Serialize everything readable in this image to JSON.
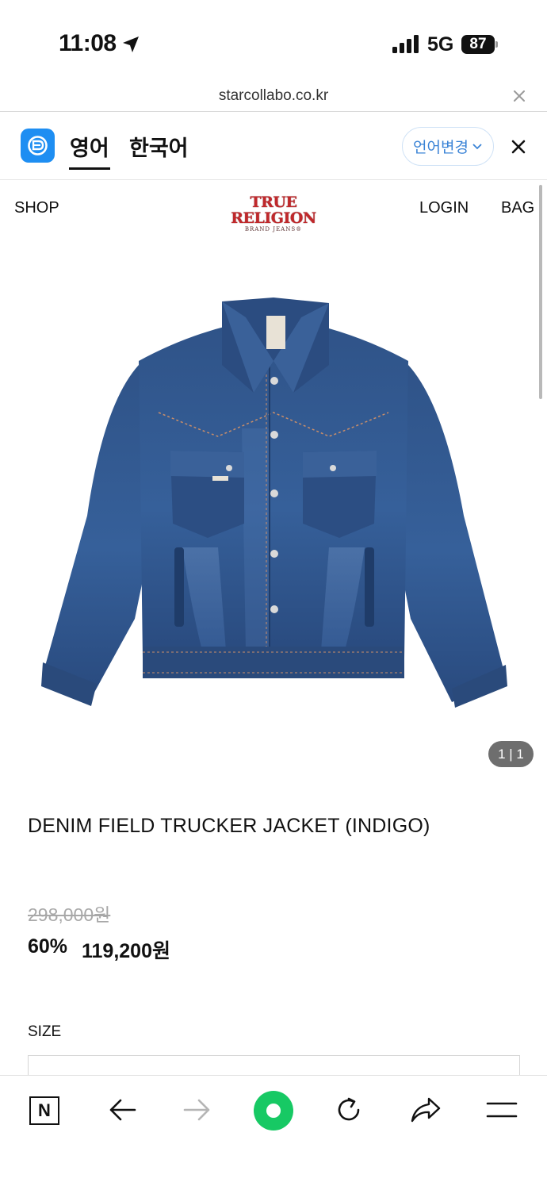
{
  "status_bar": {
    "time": "11:08",
    "network": "5G",
    "battery": "87"
  },
  "browser": {
    "url": "starcollabo.co.kr"
  },
  "translate_bar": {
    "tabs": [
      "영어",
      "한국어"
    ],
    "active_tab": "영어",
    "change_language_label": "언어변경"
  },
  "site_header": {
    "shop": "SHOP",
    "login": "LOGIN",
    "bag": "BAG",
    "brand": "TRUE RELIGION",
    "brand_sub": "BRAND JEANS®"
  },
  "product": {
    "image_counter": "1 | 1",
    "name": "DENIM FIELD TRUCKER JACKET (INDIGO)",
    "original_price": "298,000원",
    "discount": "60%",
    "sale_price": "119,200원",
    "size_label": "SIZE"
  },
  "toolbar": {
    "n_label": "N",
    "items": [
      "naver-n-icon",
      "back-arrow-icon",
      "forward-arrow-icon",
      "home-icon",
      "reload-icon",
      "share-icon",
      "menu-icon"
    ]
  },
  "colors": {
    "accent_blue": "#1e8ef2",
    "brand_red": "#c0282b",
    "home_green": "#17c964",
    "denim": "#2c4f85"
  }
}
